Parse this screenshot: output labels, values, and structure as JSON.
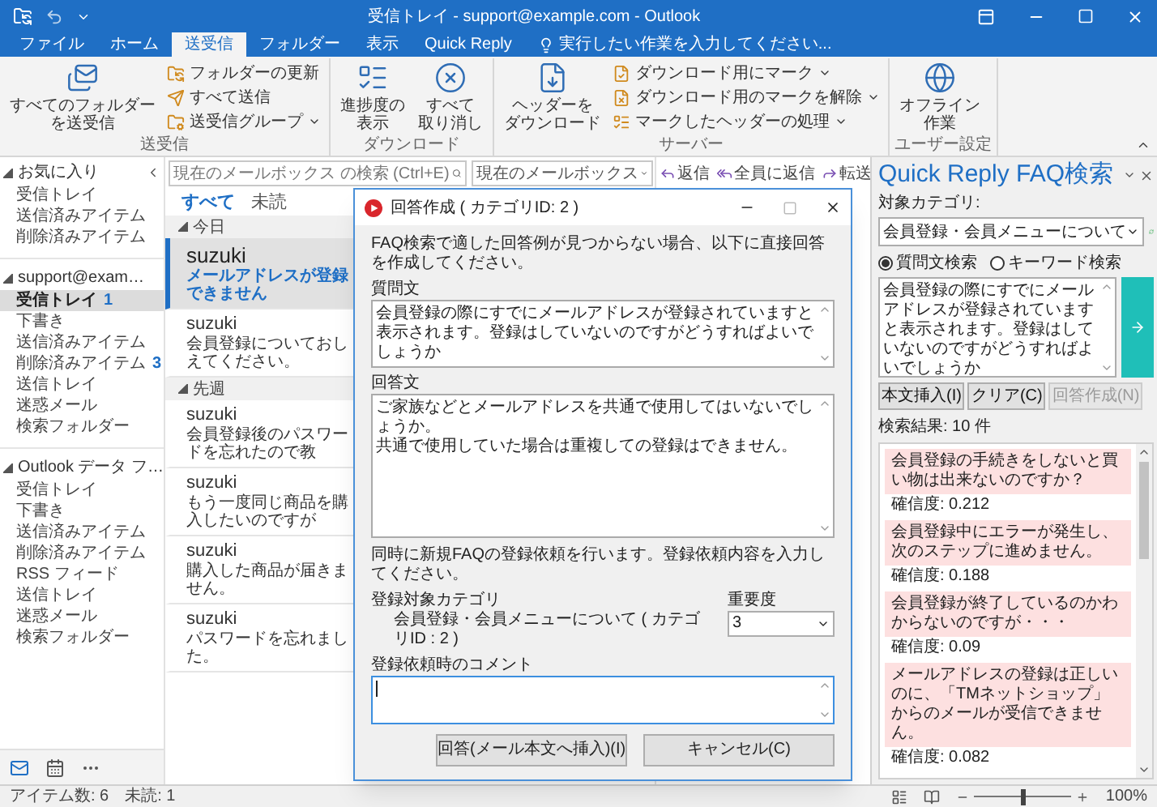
{
  "window": {
    "title": "受信トレイ - support@example.com - Outlook"
  },
  "ribbon_tabs": [
    {
      "label": "ファイル",
      "selected": false
    },
    {
      "label": "ホーム",
      "selected": false
    },
    {
      "label": "送受信",
      "selected": true
    },
    {
      "label": "フォルダー",
      "selected": false
    },
    {
      "label": "表示",
      "selected": false
    },
    {
      "label": "Quick Reply",
      "selected": false
    }
  ],
  "tell_me": "実行したい作業を入力してください...",
  "ribbon_groups": [
    {
      "label": "送受信",
      "items": [
        {
          "kind": "large",
          "lines": [
            "すべてのフォルダー",
            "を送受信"
          ]
        },
        {
          "kind": "small",
          "label": "フォルダーの更新"
        },
        {
          "kind": "small",
          "label": "すべて送信"
        },
        {
          "kind": "small",
          "label": "送受信グループ",
          "dropdown": true
        }
      ]
    },
    {
      "label": "ダウンロード",
      "items": [
        {
          "kind": "large",
          "lines": [
            "進捗度の",
            "表示"
          ]
        },
        {
          "kind": "large",
          "lines": [
            "すべて",
            "取り消し"
          ]
        }
      ]
    },
    {
      "label": "サーバー",
      "items": [
        {
          "kind": "large",
          "lines": [
            "ヘッダーを",
            "ダウンロード"
          ]
        },
        {
          "kind": "small",
          "label": "ダウンロード用にマーク",
          "dropdown": true
        },
        {
          "kind": "small",
          "label": "ダウンロード用のマークを解除",
          "dropdown": true
        },
        {
          "kind": "small",
          "label": "マークしたヘッダーの処理",
          "dropdown": true
        }
      ]
    },
    {
      "label": "ユーザー設定",
      "items": [
        {
          "kind": "large",
          "lines": [
            "オフライン",
            "作業"
          ]
        }
      ]
    }
  ],
  "folder_sections": [
    {
      "label": "お気に入り",
      "expanded": true,
      "items": [
        {
          "label": "受信トレイ",
          "selected": false
        },
        {
          "label": "送信済みアイテム",
          "selected": false
        },
        {
          "label": "削除済みアイテム",
          "selected": false
        }
      ]
    },
    {
      "label": "support@exam…",
      "expanded": true,
      "items": [
        {
          "label": "受信トレイ",
          "count": "1",
          "selected": true
        },
        {
          "label": "下書き",
          "selected": false
        },
        {
          "label": "送信済みアイテム",
          "selected": false
        },
        {
          "label": "削除済みアイテム",
          "count": "3",
          "selected": false
        },
        {
          "label": "送信トレイ",
          "selected": false
        },
        {
          "label": "迷惑メール",
          "selected": false
        },
        {
          "label": "検索フォルダー",
          "selected": false
        }
      ]
    },
    {
      "label": "Outlook データ フ…",
      "expanded": true,
      "items": [
        {
          "label": "受信トレイ",
          "selected": false
        },
        {
          "label": "下書き",
          "selected": false
        },
        {
          "label": "送信済みアイテム",
          "selected": false
        },
        {
          "label": "削除済みアイテム",
          "selected": false
        },
        {
          "label": "RSS フィード",
          "selected": false
        },
        {
          "label": "送信トレイ",
          "selected": false
        },
        {
          "label": "迷惑メール",
          "selected": false
        },
        {
          "label": "検索フォルダー",
          "selected": false
        }
      ]
    }
  ],
  "search": {
    "placeholder": "現在のメールボックス の検索 (Ctrl+E)",
    "scope": "現在のメールボックス"
  },
  "filters": [
    {
      "label": "すべて",
      "selected": true
    },
    {
      "label": "未読",
      "selected": false
    }
  ],
  "message_groups": [
    {
      "label": "今日",
      "expanded": true,
      "messages": [
        {
          "sender": "suzuki",
          "preview": "メールアドレスが登録できません",
          "selected": true,
          "unread": true
        },
        {
          "sender": "suzuki",
          "preview": "会員登録についておしえてください。",
          "selected": false,
          "unread": false
        }
      ]
    },
    {
      "label": "先週",
      "expanded": true,
      "messages": [
        {
          "sender": "suzuki",
          "preview": "会員登録後のパスワードを忘れたので教",
          "selected": false,
          "unread": false
        },
        {
          "sender": "suzuki",
          "preview": "もう一度同じ商品を購入したいのですが",
          "selected": false,
          "unread": false
        },
        {
          "sender": "suzuki",
          "preview": "購入した商品が届きません。",
          "selected": false,
          "unread": false
        },
        {
          "sender": "suzuki",
          "preview": "パスワードを忘れました。",
          "selected": false,
          "unread": false
        }
      ]
    }
  ],
  "reading_actions": [
    "返信",
    "全員に返信",
    "転送"
  ],
  "dialog": {
    "title": "回答作成 ( カテゴリID: 2 )",
    "intro": "FAQ検索で適した回答例が見つからない場合、以下に直接回答を作成してください。",
    "question_label": "質問文",
    "question": "会員登録の際にすでにメールアドレスが登録されていますと表示されます。登録はしていないのですがどうすればよいでしょうか",
    "answer_label": "回答文",
    "answer": [
      "ご家族などとメールアドレスを共通で使用してはいないでしょうか。",
      "共通で使用していた場合は重複しての登録はできません。"
    ],
    "request_note": "同時に新規FAQの登録依頼を行います。登録依頼内容を入力してください。",
    "category_label": "登録対象カテゴリ",
    "category": "会員登録・会員メニューについて ( カテゴリID : 2 )",
    "priority_label": "重要度",
    "priority": "3",
    "comment_label": "登録依頼時のコメント",
    "comment_focused": true,
    "buttons": [
      "回答(メール本文へ挿入)(I)",
      "キャンセル(C)"
    ]
  },
  "faq_pane": {
    "title": "Quick Reply FAQ検索",
    "category_label": "対象カテゴリ:",
    "category": "会員登録・会員メニューについて",
    "modes": [
      {
        "label": "質問文検索",
        "selected": true
      },
      {
        "label": "キーワード検索",
        "selected": false
      }
    ],
    "query": "会員登録の際にすでにメールアドレスが登録されていますと表示されます。登録はしていないのですがどうすればよいでしょうか",
    "buttons": [
      {
        "label": "本文挿入(I)",
        "disabled": false
      },
      {
        "label": "クリア(C)",
        "disabled": false
      },
      {
        "label": "回答作成(N)",
        "disabled": true
      }
    ],
    "result_count": "検索結果: 10 件",
    "results": [
      {
        "question": "会員登録の手続きをしないと買い物は出来ないのですか？",
        "score": "確信度: 0.212"
      },
      {
        "question": "会員登録中にエラーが発生し、次のステップに進めません。",
        "score": "確信度: 0.188"
      },
      {
        "question": "会員登録が終了しているのかわからないのですが・・・",
        "score": "確信度: 0.09"
      },
      {
        "question": "メールアドレスの登録は正しいのに、「TMネットショップ」からのメールが受信できません。",
        "score": "確信度: 0.082"
      }
    ]
  },
  "status": {
    "items": "アイテム数: 6",
    "unread": "未読: 1",
    "zoom": "100%",
    "zoom_slider": {
      "level": 0.5
    }
  }
}
